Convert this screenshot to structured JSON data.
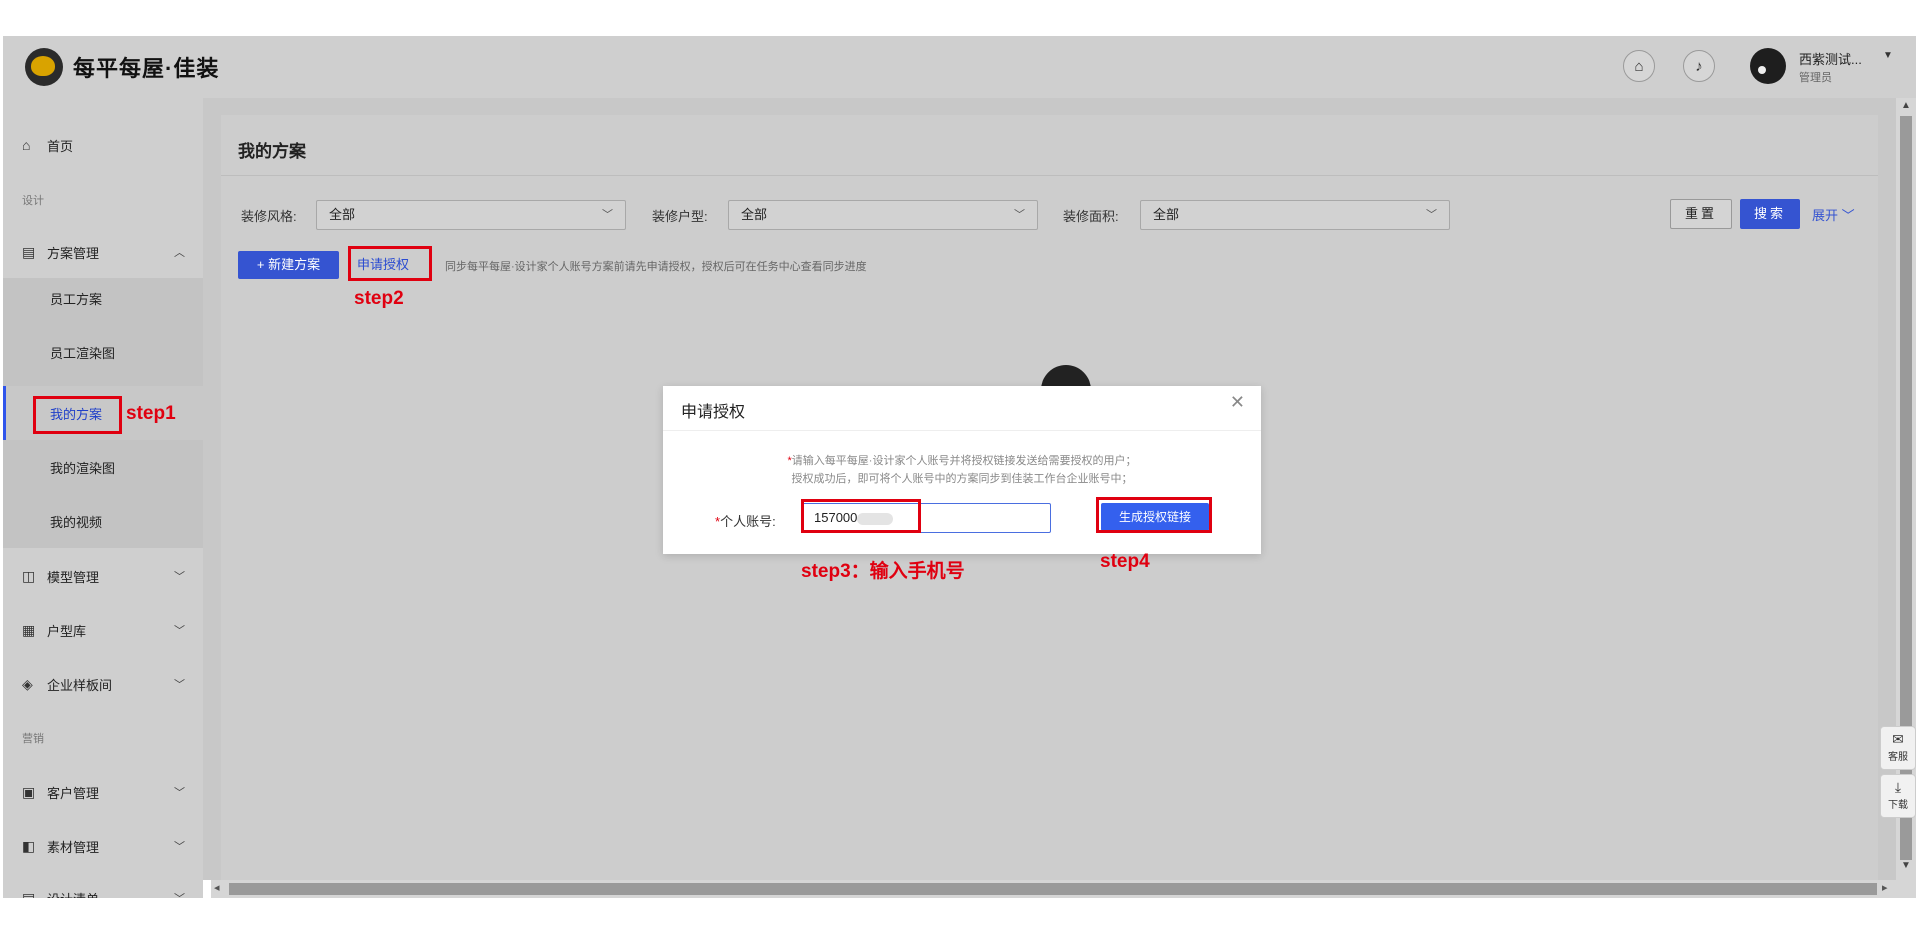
{
  "header": {
    "brand": "每平每屋·佳装",
    "user_name": "西紫测试...",
    "user_role": "管理员"
  },
  "sidebar": {
    "home": "首页",
    "group_design": "设计",
    "plan_mgmt": "方案管理",
    "sub": [
      "员工方案",
      "员工渲染图",
      "我的方案",
      "我的渲染图",
      "我的视频"
    ],
    "model_mgmt": "模型管理",
    "floorplan": "户型库",
    "showroom": "企业样板间",
    "group_marketing": "营销",
    "customer_mgmt": "客户管理",
    "material_mgmt": "素材管理",
    "design_list": "设计清单"
  },
  "main": {
    "title": "我的方案",
    "filters": [
      {
        "label": "装修风格:",
        "value": "全部"
      },
      {
        "label": "装修户型:",
        "value": "全部"
      },
      {
        "label": "装修面积:",
        "value": "全部"
      }
    ],
    "reset": "重置",
    "search": "搜索",
    "expand": "展开",
    "new_plan": "+ 新建方案",
    "apply_auth": "申请授权",
    "hint": "同步每平每屋·设计家个人账号方案前请先申请授权，授权后可在任务中心查看同步进度"
  },
  "annotations": {
    "step1": "step1",
    "step2": "step2",
    "step3": "step3：输入手机号",
    "step4": "step4",
    "color": "#e00010"
  },
  "modal": {
    "title": "申请授权",
    "note1": "请输入每平每屋·设计家个人账号并将授权链接发送给需要授权的用户；",
    "note2": "授权成功后，即可将个人账号中的方案同步到佳装工作台企业账号中；",
    "account_label": "个人账号:",
    "account_value": "157000",
    "generate": "生成授权链接"
  },
  "float": {
    "service": "客服",
    "download": "下载"
  },
  "colors": {
    "primary": "#3554d1"
  }
}
